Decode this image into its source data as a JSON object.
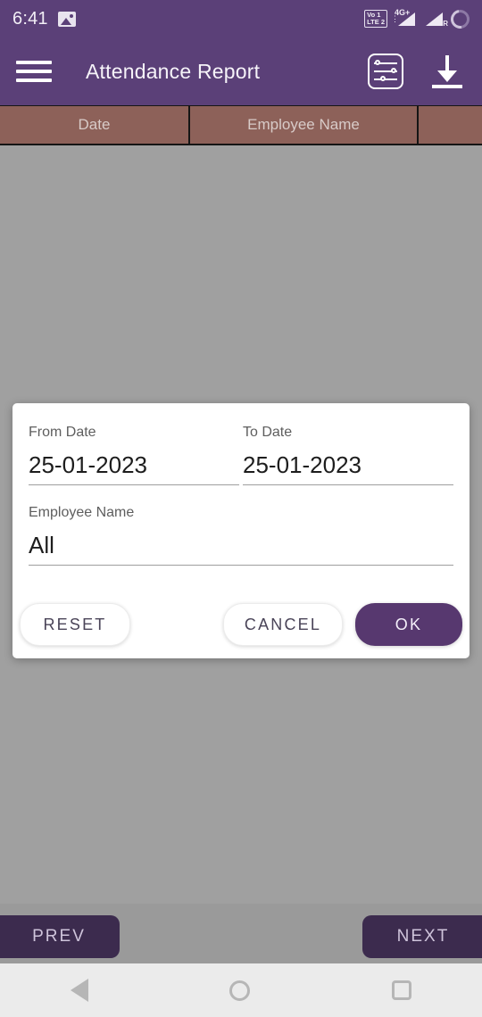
{
  "status_bar": {
    "time": "6:41",
    "image_icon": "image-icon",
    "volte_line1": "Vo  1",
    "volte_line2": "LTE 2",
    "network_type": "4G+",
    "roaming_tag": "R",
    "battery_icon": "battery-charging-icon",
    "background_color": "#5b4078"
  },
  "app_bar": {
    "menu_icon": "hamburger-menu-icon",
    "title": "Attendance Report",
    "filter_icon": "filter-sliders-icon",
    "download_icon": "download-icon",
    "background_color": "#5b4078"
  },
  "table": {
    "header_color": "#8d6159",
    "columns": [
      {
        "label": "Date"
      },
      {
        "label": "Employee Name"
      },
      {
        "label": ""
      }
    ]
  },
  "dialog": {
    "from_date": {
      "label": "From Date",
      "value": "25-01-2023"
    },
    "to_date": {
      "label": "To Date",
      "value": "25-01-2023"
    },
    "employee_name": {
      "label": "Employee Name",
      "value": "All"
    },
    "buttons": {
      "reset": "RESET",
      "cancel": "CANCEL",
      "ok": "OK"
    },
    "accent_color": "#57386f"
  },
  "pager": {
    "prev_label": "PREV",
    "next_label": "NEXT",
    "button_color": "#3c2b4e"
  },
  "nav_bar": {
    "back_icon": "back-triangle-icon",
    "home_icon": "home-circle-icon",
    "recents_icon": "recents-square-icon"
  }
}
